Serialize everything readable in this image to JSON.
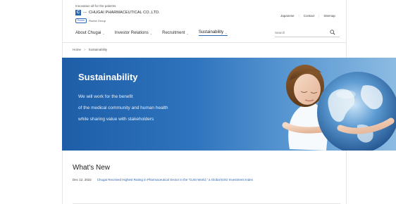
{
  "header": {
    "tagline": "Innovation all for the patients",
    "logo_mark": "C",
    "logo_dash": "—",
    "logo_text": "CHUGAI PHARMACEUTICAL CO.,LTD.",
    "sub_badge": "Roche",
    "sub_text": "Roche Group"
  },
  "utility_nav": {
    "items": [
      "Japanese",
      "Contact",
      "Sitemap"
    ],
    "separator": "|"
  },
  "main_nav": {
    "items": [
      {
        "label": "About Chugai",
        "has_dropdown": true,
        "active": false
      },
      {
        "label": "Investor Relations",
        "has_dropdown": true,
        "active": false
      },
      {
        "label": "Recruitment",
        "has_dropdown": true,
        "active": false
      },
      {
        "label": "Sustainability",
        "has_dropdown": true,
        "active": true
      }
    ],
    "chevron_glyph": "⌄"
  },
  "search": {
    "placeholder": "Search",
    "icon": "search-icon"
  },
  "breadcrumb": {
    "items": [
      "Home",
      "Sustainability"
    ],
    "separator": ">"
  },
  "hero": {
    "title": "Sustainability",
    "lines": [
      "We will work for the benefit",
      "of the medical community and human health",
      "while sharing value with stakeholders"
    ],
    "image": "girl-hugging-globe",
    "colors": {
      "gradient_start": "#1d5ea7",
      "gradient_end": "#8cbbe2"
    }
  },
  "whats_new": {
    "title": "What's New",
    "items": [
      {
        "date": "Dec 12, 2022",
        "text": "Chugai Received Highest Rating in Pharmaceutical Sector in the \"DJSI World,\" a Global ESG Investment Index"
      }
    ]
  },
  "colors": {
    "brand_blue": "#2b64b0",
    "link": "#2b64b0"
  }
}
